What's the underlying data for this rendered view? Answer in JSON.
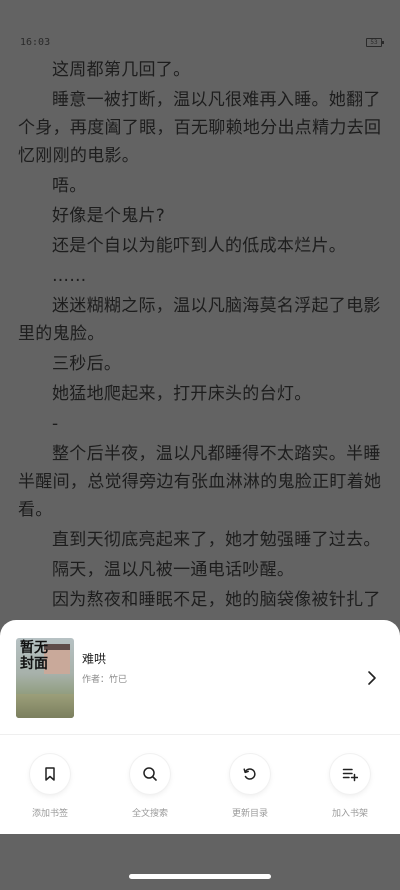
{
  "status": {
    "time": "16:03",
    "battery": "53"
  },
  "reader": {
    "paragraphs": [
      "这周都第几回了。",
      "睡意一被打断，温以凡很难再入睡。她翻了个身，再度阖了眼，百无聊赖地分出点精力去回忆刚刚的电影。",
      "唔。",
      "好像是个鬼片?",
      "还是个自以为能吓到人的低成本烂片。",
      "……",
      "迷迷糊糊之际，温以凡脑海莫名浮起了电影里的鬼脸。",
      "三秒后。",
      "她猛地爬起来，打开床头的台灯。",
      "-",
      "整个后半夜，温以凡都睡得不太踏实。半睡半醒间，总觉得旁边有张血淋淋的鬼脸正盯着她看。",
      "直到天彻底亮起来了，她才勉强睡了过去。",
      "隔天，温以凡被一通电话吵醒。",
      "因为熬夜和睡眠不足，她的脑袋像被针扎了"
    ]
  },
  "book": {
    "cover_text": "暂无封面",
    "title": "难哄",
    "author": "作者：竹已"
  },
  "actions": [
    {
      "label": "添加书签",
      "icon": "bookmark-icon"
    },
    {
      "label": "全文搜索",
      "icon": "search-icon"
    },
    {
      "label": "更新目录",
      "icon": "refresh-icon"
    },
    {
      "label": "加入书架",
      "icon": "add-to-shelf-icon"
    }
  ]
}
